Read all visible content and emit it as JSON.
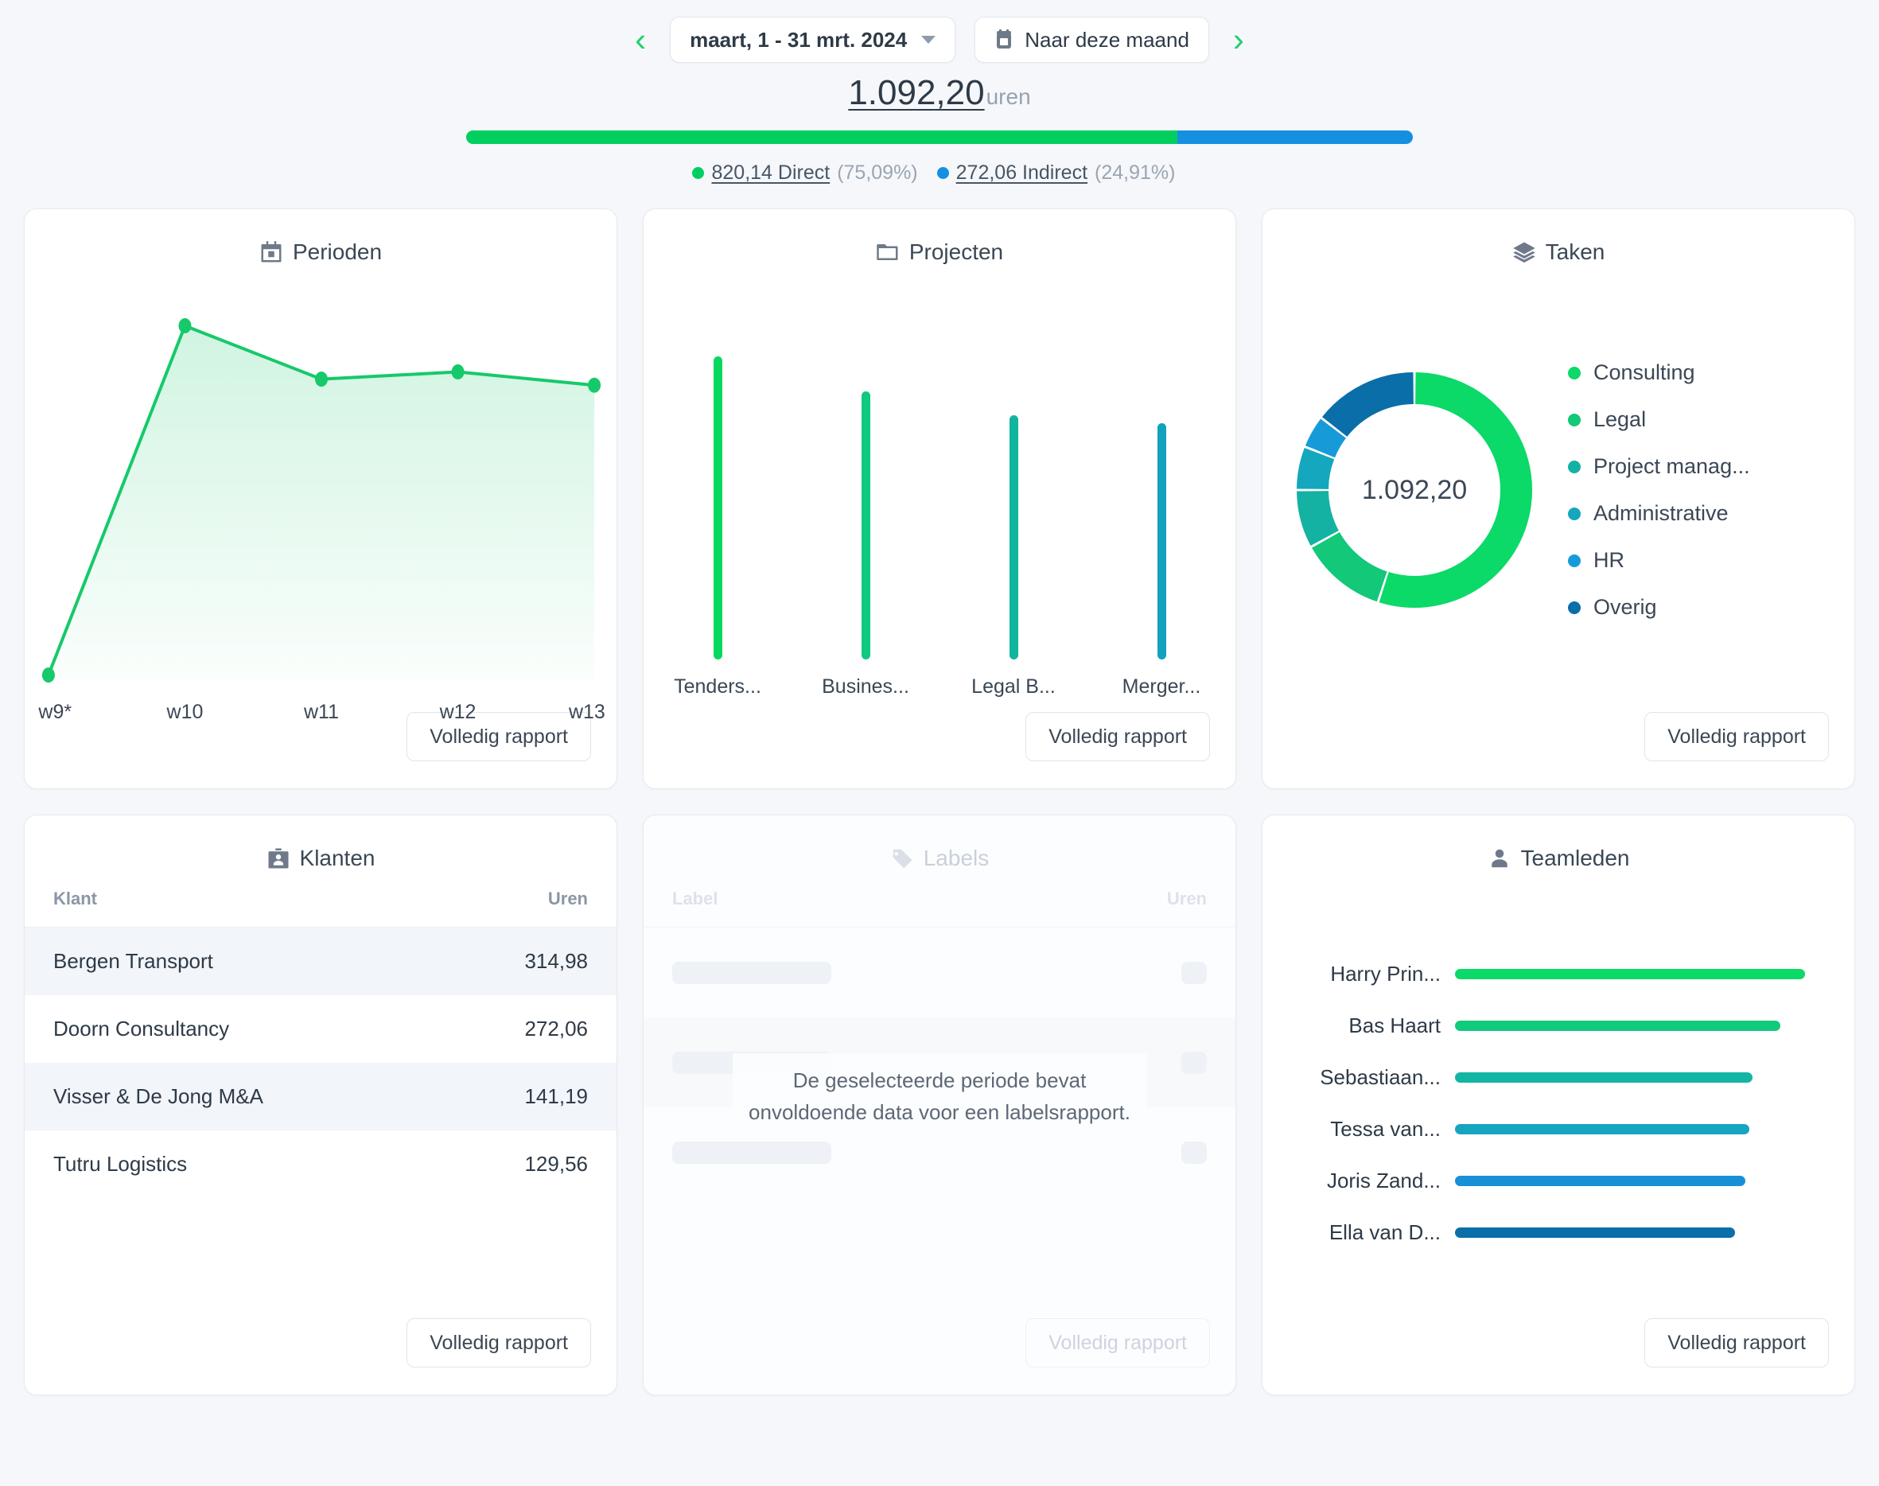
{
  "topnav": {
    "prev_label": "‹",
    "next_label": "›",
    "period_label": "maart, 1 - 31 mrt. 2024",
    "today_button": "Naar deze maand"
  },
  "summary": {
    "total": "1.092,20",
    "unit": "uren",
    "direct_value": "820,14 Direct",
    "direct_pct": "(75,09%)",
    "indirect_value": "272,06 Indirect",
    "indirect_pct": "(24,91%)",
    "direct_ratio": 75.09,
    "indirect_ratio": 24.91,
    "direct_color": "#00cf5f",
    "indirect_color": "#1590e0"
  },
  "common": {
    "full_report": "Volledig rapport"
  },
  "cards": {
    "periods": {
      "title": "Perioden",
      "icon": "calendar-icon"
    },
    "projects": {
      "title": "Projecten",
      "icon": "folder-icon"
    },
    "tasks": {
      "title": "Taken",
      "icon": "layers-icon"
    },
    "clients": {
      "title": "Klanten",
      "icon": "briefcase-person-icon"
    },
    "labels": {
      "title": "Labels",
      "icon": "tag-icon"
    },
    "team": {
      "title": "Teamleden",
      "icon": "person-icon"
    }
  },
  "clients_table": {
    "col_name": "Klant",
    "col_hours": "Uren",
    "rows": [
      {
        "name": "Bergen Transport",
        "hours": "314,98"
      },
      {
        "name": "Doorn Consultancy",
        "hours": "272,06"
      },
      {
        "name": "Visser & De Jong M&A",
        "hours": "141,19"
      },
      {
        "name": "Tutru Logistics",
        "hours": "129,56"
      }
    ]
  },
  "labels_card": {
    "col_name": "Label",
    "col_hours": "Uren",
    "empty_message": "De geselecteerde periode bevat onvoldoende data voor een labelsrapport."
  },
  "chart_data": [
    {
      "type": "line",
      "title": "Perioden",
      "categories": [
        "w9*",
        "w10",
        "w11",
        "w12",
        "w13"
      ],
      "values": [
        4,
        292,
        248,
        254,
        243
      ],
      "ylim": [
        0,
        310
      ],
      "grid": false,
      "xlabel": "",
      "ylabel": "",
      "line_color": "#16c96a",
      "area_fill": "rgba(22,201,106,0.12)"
    },
    {
      "type": "bar",
      "title": "Projecten",
      "categories": [
        "Tenders...",
        "Busines...",
        "Legal B...",
        "Merger..."
      ],
      "values": [
        305,
        270,
        246,
        238
      ],
      "ylim": [
        0,
        320
      ],
      "grid": false,
      "xlabel": "",
      "ylabel": "",
      "colors": [
        "#09d860",
        "#0ec97e",
        "#10b5a0",
        "#14a1bd"
      ]
    },
    {
      "type": "pie",
      "title": "Taken",
      "center_label": "1.092,20",
      "legend_position": "right",
      "labels": [
        "Consulting",
        "Legal",
        "Project manag...",
        "Administrative",
        "HR",
        "Overig"
      ],
      "values": [
        55.0,
        12.0,
        8.0,
        6.0,
        4.5,
        14.5
      ],
      "colors": [
        "#0bd968",
        "#13c878",
        "#14b2a2",
        "#14a7bd",
        "#179bd8",
        "#0a6ea8"
      ]
    },
    {
      "type": "bar",
      "title": "Teamleden",
      "orientation": "horizontal",
      "categories": [
        "Harry Prin...",
        "Bas Haart",
        "Sebastiaan...",
        "Tessa van...",
        "Joris Zand...",
        "Ella van D..."
      ],
      "values": [
        100,
        93,
        85,
        84,
        83,
        80
      ],
      "colors": [
        "#0bd968",
        "#11ca7a",
        "#13b5a3",
        "#16a5c1",
        "#1790d6",
        "#0a6ea8"
      ]
    }
  ]
}
